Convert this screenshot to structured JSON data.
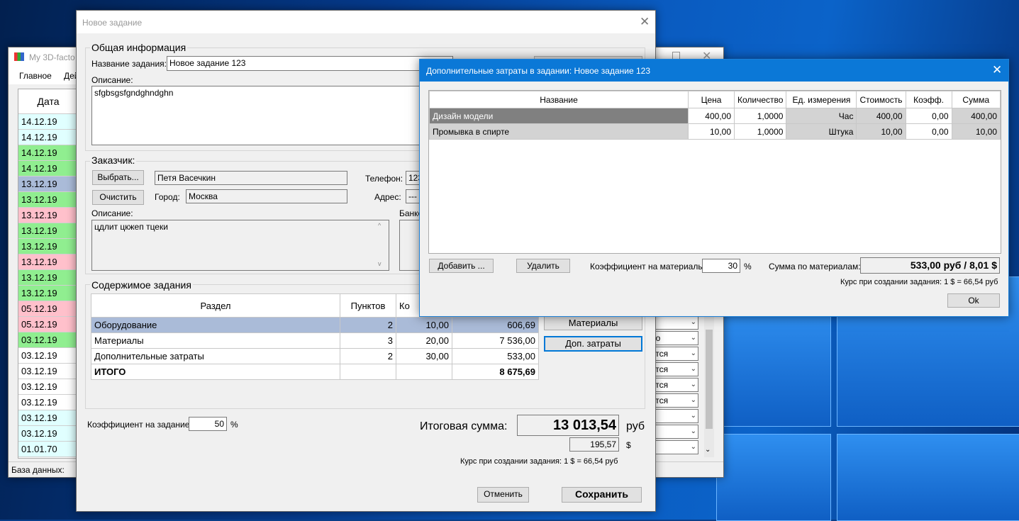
{
  "main_window": {
    "title": "My 3D-facto",
    "menu": [
      "Главное",
      "Дей"
    ],
    "date_header": "Дата",
    "rows": [
      {
        "date": "14.12.19",
        "color": "cyan"
      },
      {
        "date": "14.12.19",
        "color": "cyan"
      },
      {
        "date": "14.12.19",
        "color": "green"
      },
      {
        "date": "14.12.19",
        "color": "green"
      },
      {
        "date": "13.12.19",
        "color": "selected"
      },
      {
        "date": "13.12.19",
        "color": "green"
      },
      {
        "date": "13.12.19",
        "color": "pink"
      },
      {
        "date": "13.12.19",
        "color": "green"
      },
      {
        "date": "13.12.19",
        "color": "green"
      },
      {
        "date": "13.12.19",
        "color": "pink"
      },
      {
        "date": "13.12.19",
        "color": "green"
      },
      {
        "date": "13.12.19",
        "color": "green"
      },
      {
        "date": "05.12.19",
        "color": "pink"
      },
      {
        "date": "05.12.19",
        "color": "pink"
      },
      {
        "date": "03.12.19",
        "color": "green"
      },
      {
        "date": "03.12.19",
        "color": "white"
      },
      {
        "date": "03.12.19",
        "color": "white"
      },
      {
        "date": "03.12.19",
        "color": "white"
      },
      {
        "date": "03.12.19",
        "color": "white"
      },
      {
        "date": "03.12.19",
        "color": "cyan"
      },
      {
        "date": "03.12.19",
        "color": "cyan"
      },
      {
        "date": "01.01.70",
        "color": "cyan"
      }
    ],
    "status_combos": [
      "о",
      "но",
      "ется",
      "ется",
      "ется",
      "ется",
      "",
      "",
      ""
    ],
    "statusbar": "База данных:"
  },
  "task_dialog": {
    "title": "Новое задание",
    "general_group": "Общая информация",
    "name_label": "Название задания:",
    "name_value": "Новое задание 123",
    "desc_label": "Описание:",
    "desc_value": "sfgbsgsfgndghndghn",
    "customer_group": "Заказчик:",
    "select_button": "Выбрать...",
    "clear_button": "Очистить",
    "customer_name": "Петя Васечкин",
    "city_label": "Город:",
    "city_value": "Москва",
    "phone_label": "Телефон:",
    "phone_value": "123",
    "address_label": "Адрес:",
    "address_value": "---",
    "customer_desc_label": "Описание:",
    "customer_desc_value": "цдлит цкжеп тцеки",
    "bank_label": "Банко",
    "content_group": "Содержимое задания",
    "content_headers": [
      "Раздел",
      "Пунктов",
      "Ко",
      ""
    ],
    "content_rows": [
      {
        "section": "Оборудование",
        "items": "2",
        "coef": "10,00",
        "sum": "606,69"
      },
      {
        "section": "Материалы",
        "items": "3",
        "coef": "20,00",
        "sum": "7 536,00"
      },
      {
        "section": "Дополнительные затраты",
        "items": "2",
        "coef": "30,00",
        "sum": "533,00"
      }
    ],
    "total_label": "ИТОГО",
    "total_sum": "8 675,69",
    "materials_button": "Материалы",
    "extra_button": "Доп. затраты",
    "task_coef_label": "Коэффициент на задание:",
    "task_coef_value": "50",
    "percent": "%",
    "total_amount_label": "Итоговая сумма:",
    "total_amount_value": "13 013,54",
    "currency_rub": "руб",
    "total_usd_value": "195,57",
    "currency_usd": "$",
    "rate_text": "Курс при создании задания: 1 $ = 66,54 руб",
    "cancel_button": "Отменить",
    "save_button": "Сохранить"
  },
  "extra_dialog": {
    "title": "Дополнительные затраты в задании: Новое задание 123",
    "headers": [
      "Название",
      "Цена",
      "Количество",
      "Ед. измерения",
      "Стоимость",
      "Коэфф.",
      "Сумма"
    ],
    "rows": [
      {
        "name": "Дизайн модели",
        "price": "400,00",
        "qty": "1,0000",
        "unit": "Час",
        "cost": "400,00",
        "coef": "0,00",
        "sum": "400,00"
      },
      {
        "name": "Промывка в спирте",
        "price": "10,00",
        "qty": "1,0000",
        "unit": "Штука",
        "cost": "10,00",
        "coef": "0,00",
        "sum": "10,00"
      }
    ],
    "add_button": "Добавить ...",
    "delete_button": "Удалить",
    "mat_coef_label": "Коэффициент на материалы:",
    "mat_coef_value": "30",
    "percent": "%",
    "mat_sum_label": "Сумма по материалам:",
    "mat_sum_value": "533,00 руб / 8,01 $",
    "rate_text": "Курс при создании задания: 1 $ = 66,54 руб",
    "ok_button": "Ok"
  }
}
